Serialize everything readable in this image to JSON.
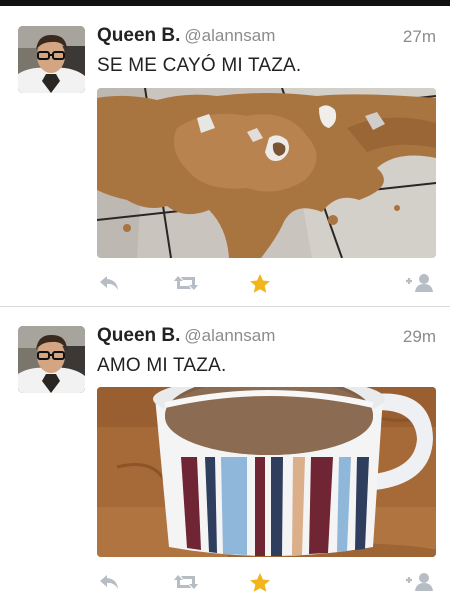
{
  "tweets": [
    {
      "name": "Queen B.",
      "handle": "@alannsam",
      "time": "27m",
      "text": "SE ME CAYÓ MI TAZA.",
      "media": "spilled-coffee-photo",
      "favorited": true
    },
    {
      "name": "Queen B.",
      "handle": "@alannsam",
      "time": "29m",
      "text": "AMO MI TAZA.",
      "media": "coffee-mug-photo",
      "favorited": true
    }
  ],
  "icons": {
    "reply": "reply-icon",
    "retweet": "retweet-icon",
    "favorite": "star-icon",
    "follow": "follow-icon"
  },
  "colors": {
    "name": "#222222",
    "meta": "#8c8c8c",
    "action": "#b6bdc4",
    "favorite": "#f2b51c"
  }
}
